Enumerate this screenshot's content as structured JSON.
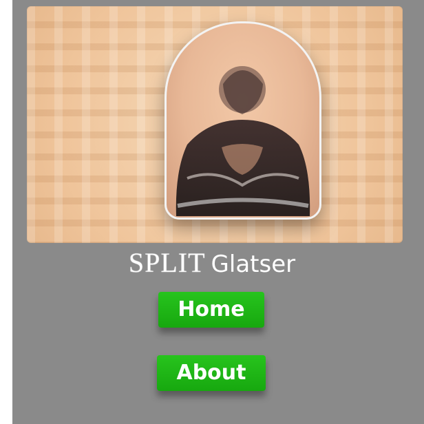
{
  "hero": {
    "icon": "portrait-image",
    "colors": {
      "accent": "#f1c8a0",
      "frame": "#f3f3f3"
    }
  },
  "title": {
    "part1": "SPLIT",
    "part2": "Glatser"
  },
  "nav": {
    "home_label": "Home",
    "about_label": "About"
  },
  "colors": {
    "panel": "#8a8a8a",
    "button": "#1fb61a"
  }
}
